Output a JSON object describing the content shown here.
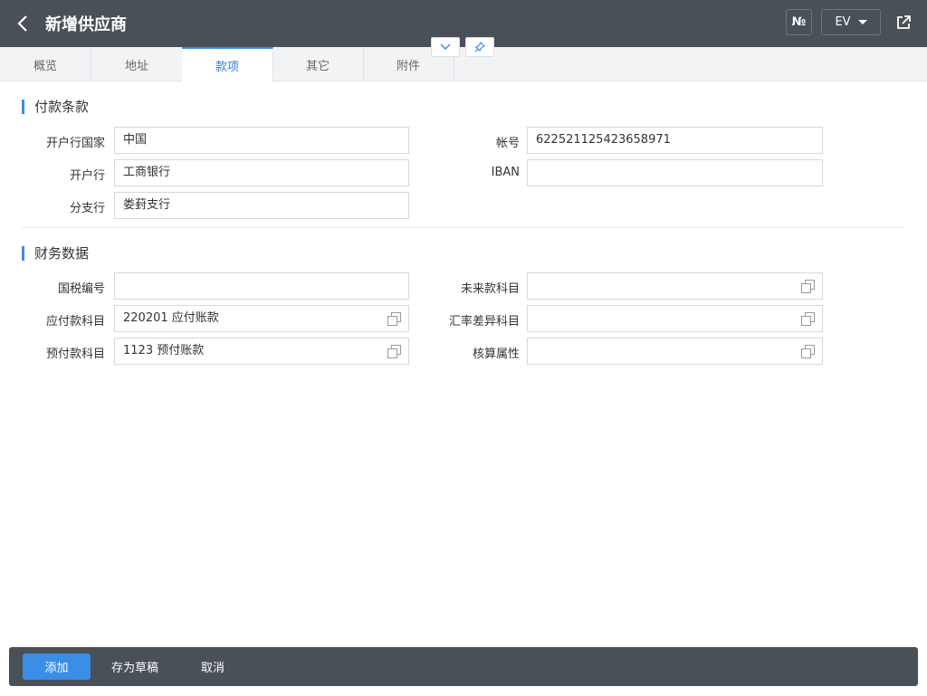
{
  "header": {
    "title": "新增供应商",
    "number_label": "№",
    "lang": "EV"
  },
  "tabs": [
    {
      "label": "概览"
    },
    {
      "label": "地址"
    },
    {
      "label": "款项",
      "active": true
    },
    {
      "label": "其它"
    },
    {
      "label": "附件"
    }
  ],
  "payment": {
    "title": "付款条款",
    "bank_country_label": "开户行国家",
    "bank_country": "中国",
    "bank_label": "开户行",
    "bank": "工商银行",
    "branch_label": "分支行",
    "branch": "娄葑支行",
    "account_label": "帐号",
    "account": "622521125423658971",
    "iban_label": "IBAN",
    "iban": ""
  },
  "finance": {
    "title": "财务数据",
    "tax_no_label": "国税编号",
    "tax_no": "",
    "payable_label": "应付款科目",
    "payable": "220201 应付账款",
    "prepaid_label": "预付款科目",
    "prepaid": "1123 预付账款",
    "future_label": "未来款科目",
    "future": "",
    "fx_diff_label": "汇率差异科目",
    "fx_diff": "",
    "accounting_attr_label": "核算属性",
    "accounting_attr": ""
  },
  "footer": {
    "add": "添加",
    "save_draft": "存为草稿",
    "cancel": "取消"
  },
  "colors": {
    "header_bg": "#495057",
    "accent": "#3a8ee6"
  }
}
